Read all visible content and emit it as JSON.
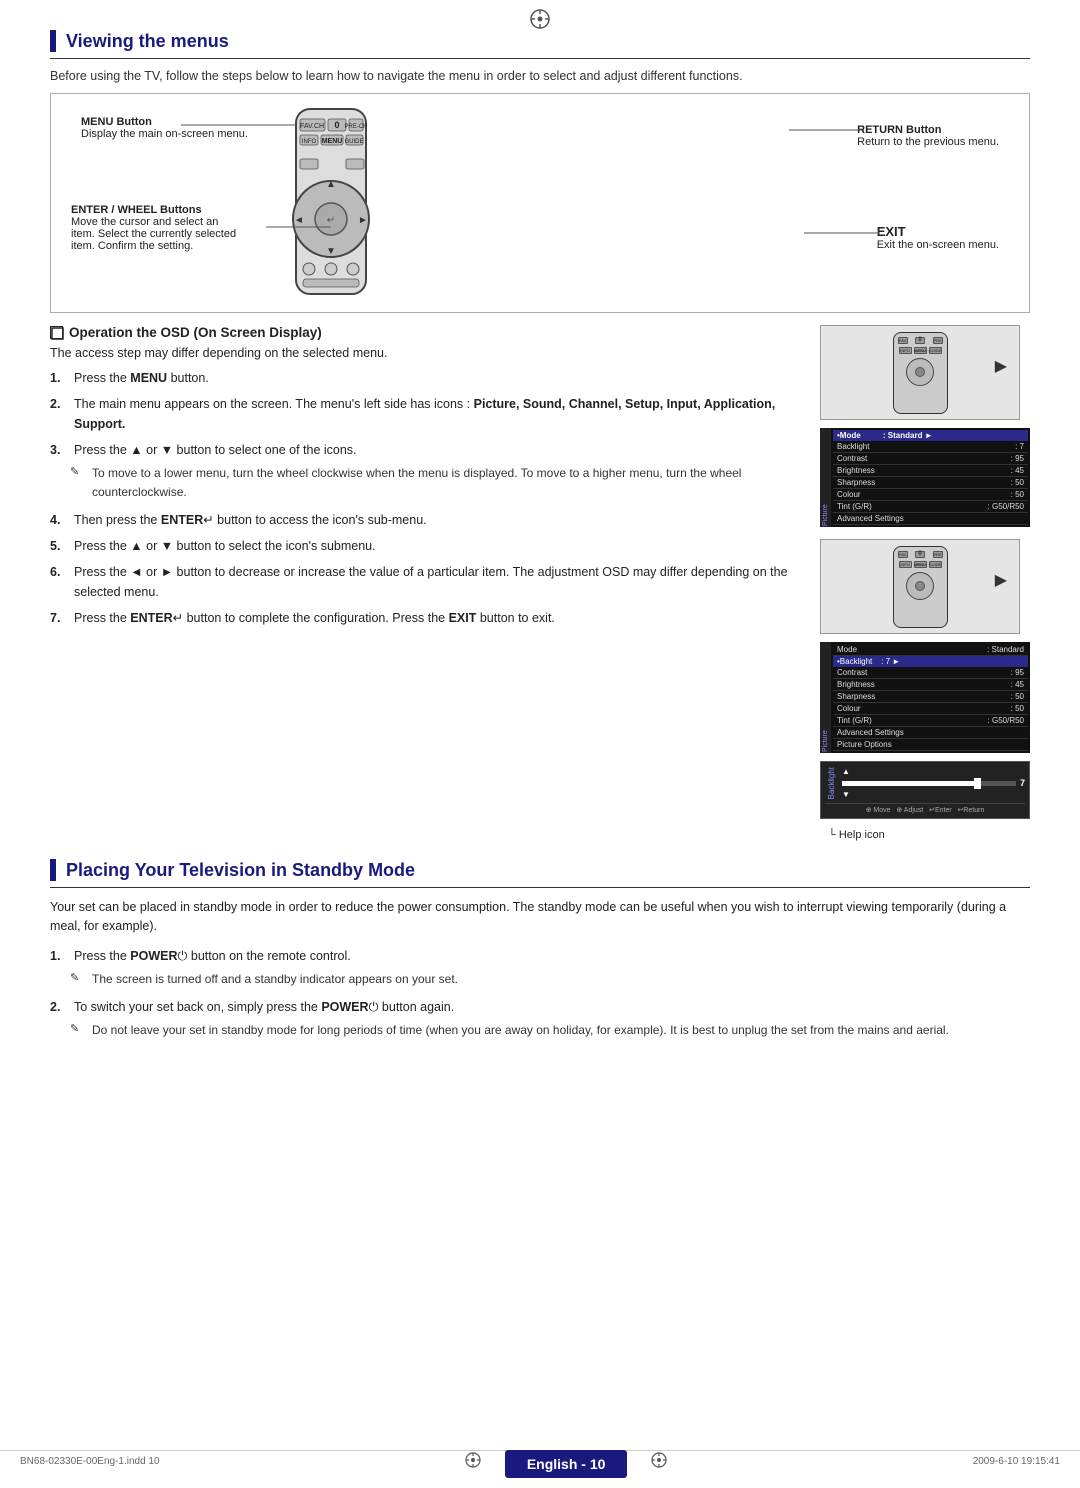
{
  "page": {
    "top_compass": "⊕",
    "bottom_left_compass": "⊕",
    "bottom_right_compass": "⊕"
  },
  "section1": {
    "title": "Viewing the menus",
    "intro": "Before using the TV, follow the steps below to learn how to navigate the menu in order to select and adjust different functions.",
    "menu_button_label": "MENU Button",
    "menu_button_desc": "Display the main on-screen menu.",
    "enter_label": "ENTER  / WHEEL Buttons",
    "enter_desc1": "Move the cursor and select an",
    "enter_desc2": "item. Select the currently selected",
    "enter_desc3": "item. Confirm the setting.",
    "return_label": "RETURN Button",
    "return_desc": "Return to the previous menu.",
    "exit_label": "EXIT",
    "exit_desc": "Exit the on-screen menu."
  },
  "osd": {
    "heading": "Operation the OSD (On Screen Display)",
    "access_step": "The access step may differ depending on the selected menu.",
    "steps": [
      {
        "num": "1.",
        "text": "Press the ",
        "bold": "MENU",
        "text2": " button.",
        "note": null
      },
      {
        "num": "2.",
        "text": "The main menu appears on the screen. The menu's left side has icons : ",
        "bold": "Picture, Sound, Channel, Setup, Input, Application, Support.",
        "note": null
      },
      {
        "num": "3.",
        "text": "Press the ▲ or ▼ button to select one of the icons.",
        "note": "To move to a lower menu, turn the wheel clockwise when the menu is displayed. To move to a higher menu, turn the wheel counterclockwise."
      },
      {
        "num": "4.",
        "text": "Then press the ",
        "bold": "ENTER",
        "text2": " button to access the icon's sub-menu.",
        "note": null
      },
      {
        "num": "5.",
        "text": "Press the ▲ or ▼ button to select the icon's submenu.",
        "note": null
      },
      {
        "num": "6.",
        "text": "Press the ◄ or ► button to decrease or increase the value of a particular item. The adjustment OSD may differ depending on the selected menu.",
        "note": null
      },
      {
        "num": "7.",
        "text": "Press the ",
        "bold": "ENTER",
        "text2": " button to complete the configuration. Press the ",
        "bold2": "EXIT",
        "text3": " button to exit.",
        "note": null
      }
    ],
    "help_icon_label": "└ Help icon"
  },
  "section2": {
    "title": "Placing Your Television in Standby Mode",
    "intro": "Your set can be placed in standby mode in order to reduce the power consumption. The standby mode can be useful when you wish to interrupt viewing temporarily (during a meal, for example).",
    "steps": [
      {
        "num": "1.",
        "text": "Press the ",
        "bold": "POWER",
        "text2": " button on the remote control.",
        "note": "The screen is turned off and a standby indicator appears on your set."
      },
      {
        "num": "2.",
        "text": "To switch your set back on, simply press the ",
        "bold": "POWER",
        "text2": " button again.",
        "note": "Do not leave your set in standby mode for long periods of time (when you are away on holiday, for example). It is best to unplug the set from the mains and aerial."
      }
    ]
  },
  "footer": {
    "left": "BN68-02330E-00Eng-1.indd  10",
    "center": "English - 10",
    "right": "2009-6-10  19:15:41"
  },
  "menu_screen1": {
    "title": "Picture",
    "rows": [
      {
        "label": "•Mode",
        "value": ": Standard",
        "arrow": "►"
      },
      {
        "label": "Backlight",
        "value": ": 7"
      },
      {
        "label": "Contrast",
        "value": ": 95"
      },
      {
        "label": "Brightness",
        "value": ": 45"
      },
      {
        "label": "Sharpness",
        "value": ": 50"
      },
      {
        "label": "Colour",
        "value": ": 50"
      },
      {
        "label": "Tint (G/R)",
        "value": ": G50/R50"
      },
      {
        "label": "Advanced Settings",
        "value": ""
      }
    ]
  },
  "menu_screen2": {
    "title": "Picture",
    "rows": [
      {
        "label": "Mode",
        "value": ": Standard"
      },
      {
        "label": "•Backlight",
        "value": ": 7",
        "arrow": "►"
      },
      {
        "label": "Contrast",
        "value": ": 95"
      },
      {
        "label": "Brightness",
        "value": ": 45"
      },
      {
        "label": "Sharpness",
        "value": ": 50"
      },
      {
        "label": "Colour",
        "value": ": 50"
      },
      {
        "label": "Tint (G/R)",
        "value": ": G50/R50"
      },
      {
        "label": "Advanced Settings",
        "value": ""
      },
      {
        "label": "Picture Options",
        "value": ""
      }
    ]
  },
  "backlight": {
    "title": "Backlight",
    "triangle_up": "▲",
    "slider_value": "7",
    "triangle_down": "▼",
    "help": "⊕ Move  ⊕ Adjust  ↵ Enter  ↩ Return"
  }
}
